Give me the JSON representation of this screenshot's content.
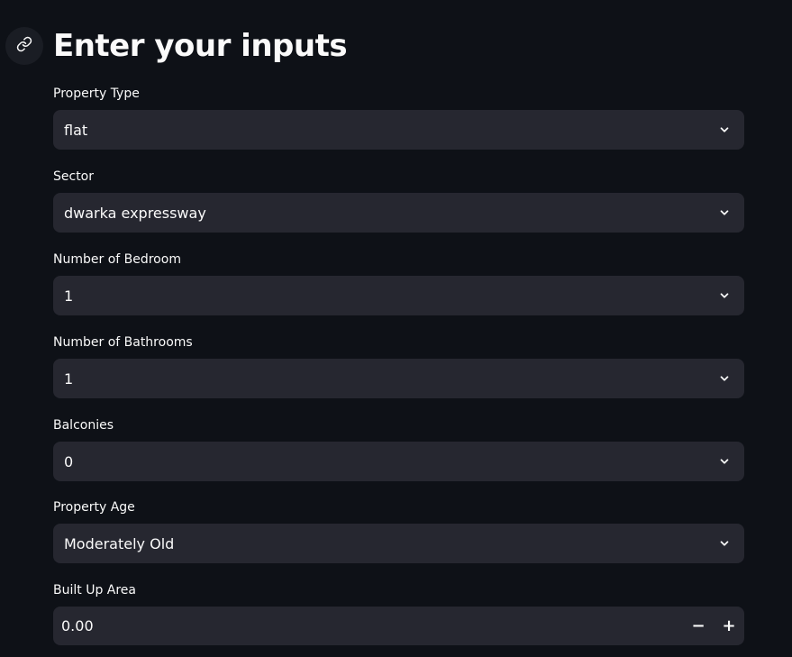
{
  "header": {
    "title": "Enter your inputs",
    "anchor_icon": "link-icon"
  },
  "fields": {
    "property_type": {
      "label": "Property Type",
      "value": "flat"
    },
    "sector": {
      "label": "Sector",
      "value": "dwarka expressway"
    },
    "bedrooms": {
      "label": "Number of Bedroom",
      "value": "1"
    },
    "bathrooms": {
      "label": "Number of Bathrooms",
      "value": "1"
    },
    "balconies": {
      "label": "Balconies",
      "value": "0"
    },
    "property_age": {
      "label": "Property Age",
      "value": "Moderately Old"
    },
    "built_up_area": {
      "label": "Built Up Area",
      "value": "0.00",
      "decrement": "−",
      "increment": "+"
    }
  },
  "colors": {
    "background": "#0e1117",
    "input_background": "#262730",
    "text": "#fafafa"
  }
}
